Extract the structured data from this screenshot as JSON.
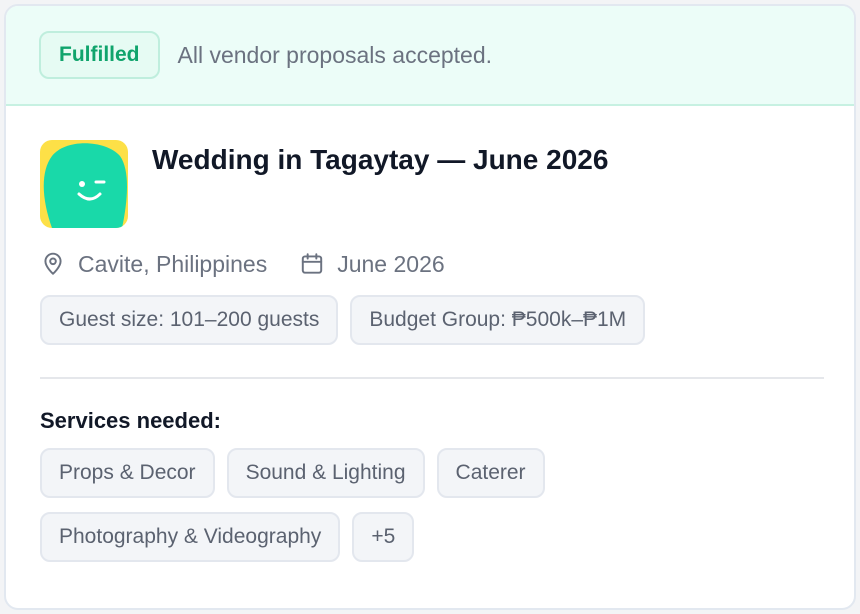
{
  "banner": {
    "status_label": "Fulfilled",
    "message": "All vendor proposals accepted."
  },
  "event": {
    "title": "Wedding in Tagaytay — June 2026",
    "location": "Cavite, Philippines",
    "date": "June 2026",
    "tags": [
      "Guest size: 101–200 guests",
      "Budget Group: ₱500k–₱1M"
    ]
  },
  "services": {
    "heading": "Services needed:",
    "items": [
      "Props & Decor",
      "Sound & Lighting",
      "Caterer",
      "Photography & Videography"
    ],
    "more_label": "+5"
  },
  "colors": {
    "accent": "#10a46c",
    "avatar_bg": "#fde047",
    "avatar_face": "#19d9a9"
  },
  "icons": {
    "location": "map-pin-icon",
    "date": "calendar-icon"
  }
}
